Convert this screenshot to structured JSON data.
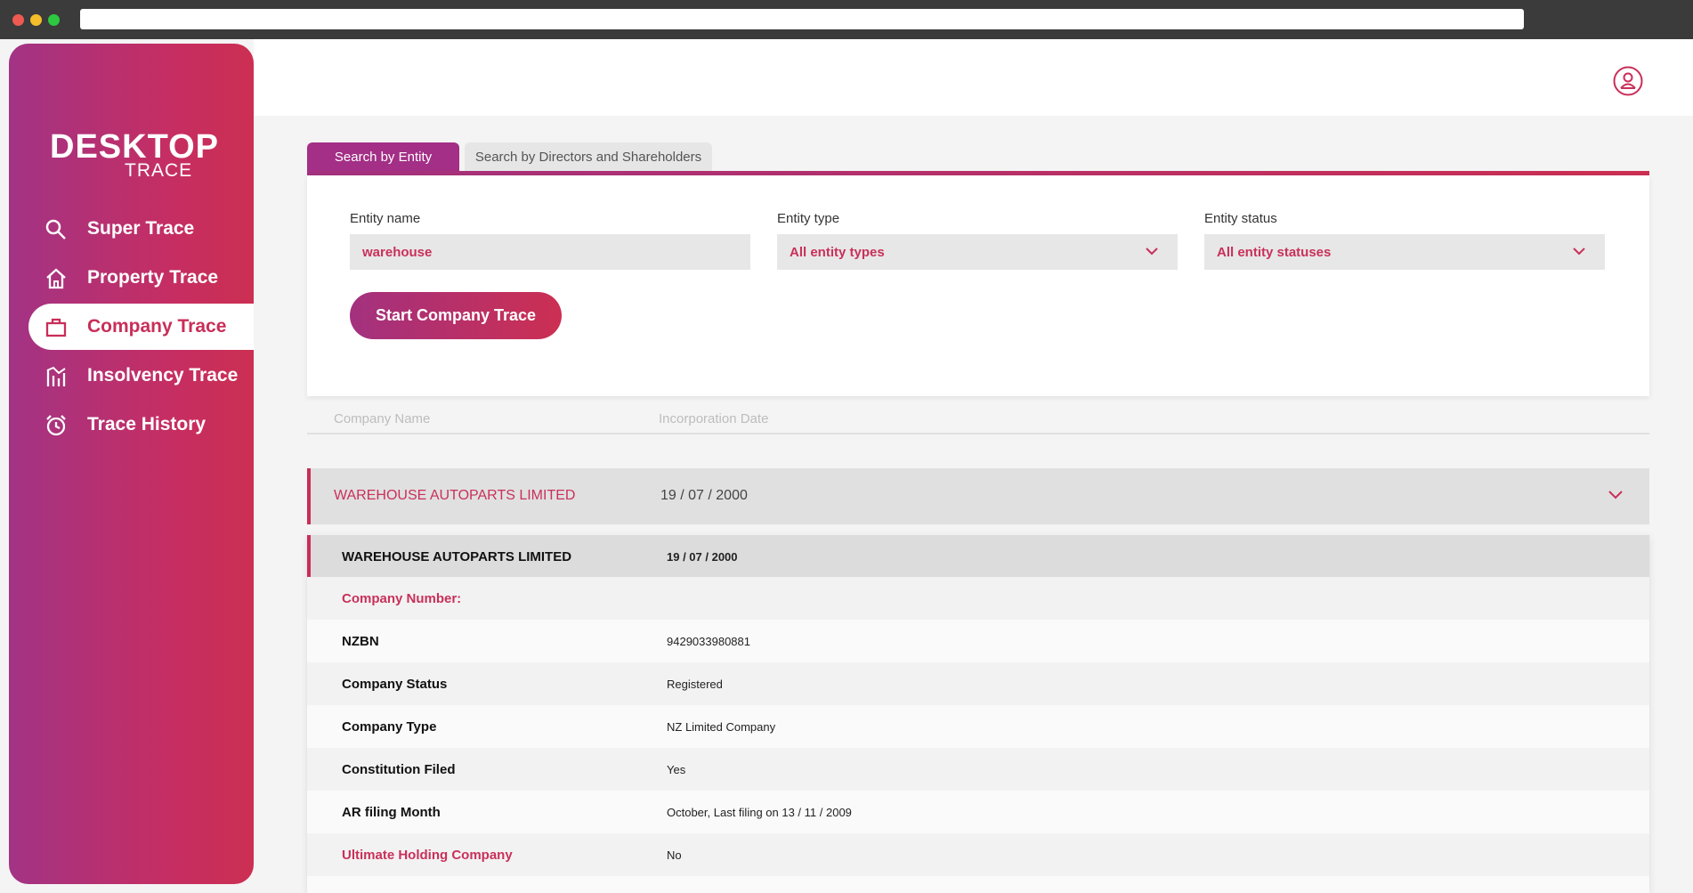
{
  "sidebar": {
    "logo": {
      "line1": "DESKTOP",
      "line2": "TRACE"
    },
    "items": [
      {
        "label": "Super Trace",
        "icon": "search-icon"
      },
      {
        "label": "Property Trace",
        "icon": "home-icon"
      },
      {
        "label": "Company Trace",
        "icon": "briefcase-icon",
        "active": true
      },
      {
        "label": "Insolvency Trace",
        "icon": "chart-icon"
      },
      {
        "label": "Trace History",
        "icon": "alarm-clock-icon"
      }
    ]
  },
  "header": {
    "user_icon": "user-icon"
  },
  "tabs": [
    {
      "label": "Search by Entity",
      "active": true
    },
    {
      "label": "Search by Directors and Shareholders",
      "active": false
    }
  ],
  "form": {
    "entity_name": {
      "label": "Entity name",
      "value": "warehouse"
    },
    "entity_type": {
      "label": "Entity type",
      "value": "All entity types"
    },
    "entity_status": {
      "label": "Entity status",
      "value": "All entity statuses"
    },
    "submit_label": "Start Company Trace"
  },
  "results": {
    "columns": [
      "Company Name",
      "Incorporation Date"
    ],
    "rows": [
      {
        "name": "WAREHOUSE AUTOPARTS LIMITED",
        "date": "19 / 07 / 2000"
      }
    ]
  },
  "detail": {
    "title": "WAREHOUSE AUTOPARTS LIMITED",
    "date": "19 / 07 / 2000",
    "company_number_label": "Company Number:",
    "fields": [
      {
        "key": "NZBN",
        "value": "9429033980881"
      },
      {
        "key": "Company Status",
        "value": "Registered"
      },
      {
        "key": "Company Type",
        "value": "NZ Limited Company"
      },
      {
        "key": "Constitution Filed",
        "value": "Yes"
      },
      {
        "key": "AR filing Month",
        "value": "October, Last filing on 13 / 11 / 2009"
      },
      {
        "key": "Ultimate Holding Company",
        "value": "No"
      }
    ]
  },
  "colors": {
    "accent": "#c92e58",
    "purple": "#a23385"
  }
}
